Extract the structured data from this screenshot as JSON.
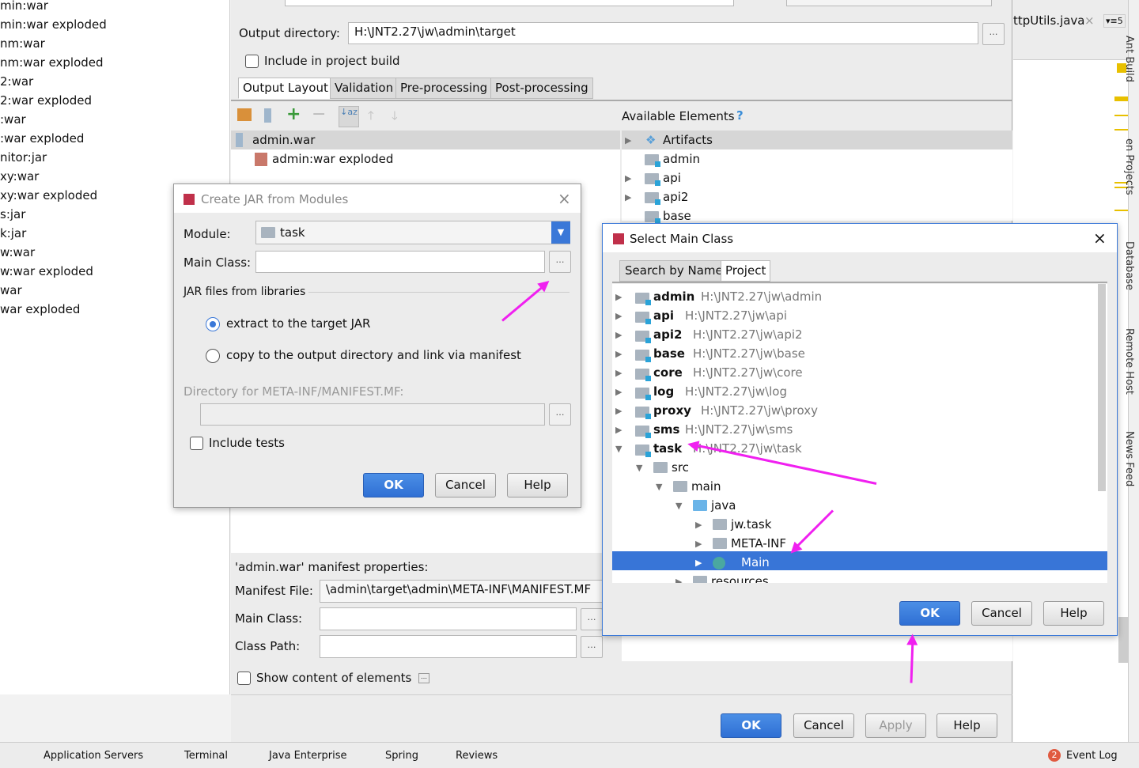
{
  "left_list": [
    "min:war",
    "min:war exploded",
    "nm:war",
    "nm:war exploded",
    "2:war",
    "2:war exploded",
    ":war",
    ":war exploded",
    "nitor:jar",
    "xy:war",
    "xy:war exploded",
    "s:jar",
    "k:jar",
    "w:war",
    "w:war exploded",
    "war",
    "war exploded"
  ],
  "artifact": {
    "output_dir_label": "Output directory:",
    "output_dir": "H:\\JNT2.27\\jw\\admin\\target",
    "include_build": "Include in project build",
    "tabs": [
      "Output Layout",
      "Validation",
      "Pre-processing",
      "Post-processing"
    ],
    "available_label": "Available Elements",
    "help_mark": "?",
    "layout_items": [
      "admin.war",
      "admin:war exploded"
    ],
    "available_items": [
      "Artifacts",
      "admin",
      "api",
      "api2",
      "base"
    ],
    "manifest_title": "'admin.war' manifest properties:",
    "manifest_file_label": "Manifest File:",
    "manifest_file": "\\admin\\target\\admin\\META-INF\\MANIFEST.MF",
    "main_class_label": "Main Class:",
    "class_path_label": "Class Path:",
    "show_content": "Show content of elements",
    "buttons": {
      "ok": "OK",
      "cancel": "Cancel",
      "apply": "Apply",
      "help": "Help"
    }
  },
  "editor": {
    "tab": "ttpUtils.java",
    "tab_close": "×",
    "tab_count": "▾≡5"
  },
  "tool_windows": [
    "Ant Build",
    "en Projects",
    "Database",
    "Remote Host",
    "News Feed"
  ],
  "status_bar": {
    "items": [
      "Application Servers",
      "Terminal",
      "Java Enterprise",
      "Spring",
      "Reviews"
    ],
    "event_log": "Event Log",
    "event_count": "2"
  },
  "jar_dialog": {
    "title": "Create JAR from Modules",
    "close": "×",
    "module_label": "Module:",
    "module": "task",
    "main_class_label": "Main Class:",
    "main_class": "",
    "libs_label": "JAR files from libraries",
    "opt_extract": "extract to the target JAR",
    "opt_copy": "copy to the output directory and link via manifest",
    "manifest_dir_label": "Directory for META-INF/MANIFEST.MF:",
    "include_tests": "Include tests",
    "buttons": {
      "ok": "OK",
      "cancel": "Cancel",
      "help": "Help"
    }
  },
  "main_class_dialog": {
    "title": "Select Main Class",
    "close": "×",
    "tabs": [
      "Search by Name",
      "Project"
    ],
    "modules": [
      {
        "name": "admin",
        "path": "H:\\JNT2.27\\jw\\admin"
      },
      {
        "name": "api",
        "path": "H:\\JNT2.27\\jw\\api"
      },
      {
        "name": "api2",
        "path": "H:\\JNT2.27\\jw\\api2"
      },
      {
        "name": "base",
        "path": "H:\\JNT2.27\\jw\\base"
      },
      {
        "name": "core",
        "path": "H:\\JNT2.27\\jw\\core"
      },
      {
        "name": "log",
        "path": "H:\\JNT2.27\\jw\\log"
      },
      {
        "name": "proxy",
        "path": "H:\\JNT2.27\\jw\\proxy"
      },
      {
        "name": "sms",
        "path": "H:\\JNT2.27\\jw\\sms"
      },
      {
        "name": "task",
        "path": "H:\\JNT2.27\\jw\\task"
      }
    ],
    "tree": [
      "src",
      "main",
      "java",
      "jw.task",
      "META-INF",
      "Main",
      "resources"
    ],
    "selected": "Main",
    "buttons": {
      "ok": "OK",
      "cancel": "Cancel",
      "help": "Help"
    }
  },
  "colors": {
    "accent": "#3875d7",
    "annotation": "#f020f0"
  }
}
